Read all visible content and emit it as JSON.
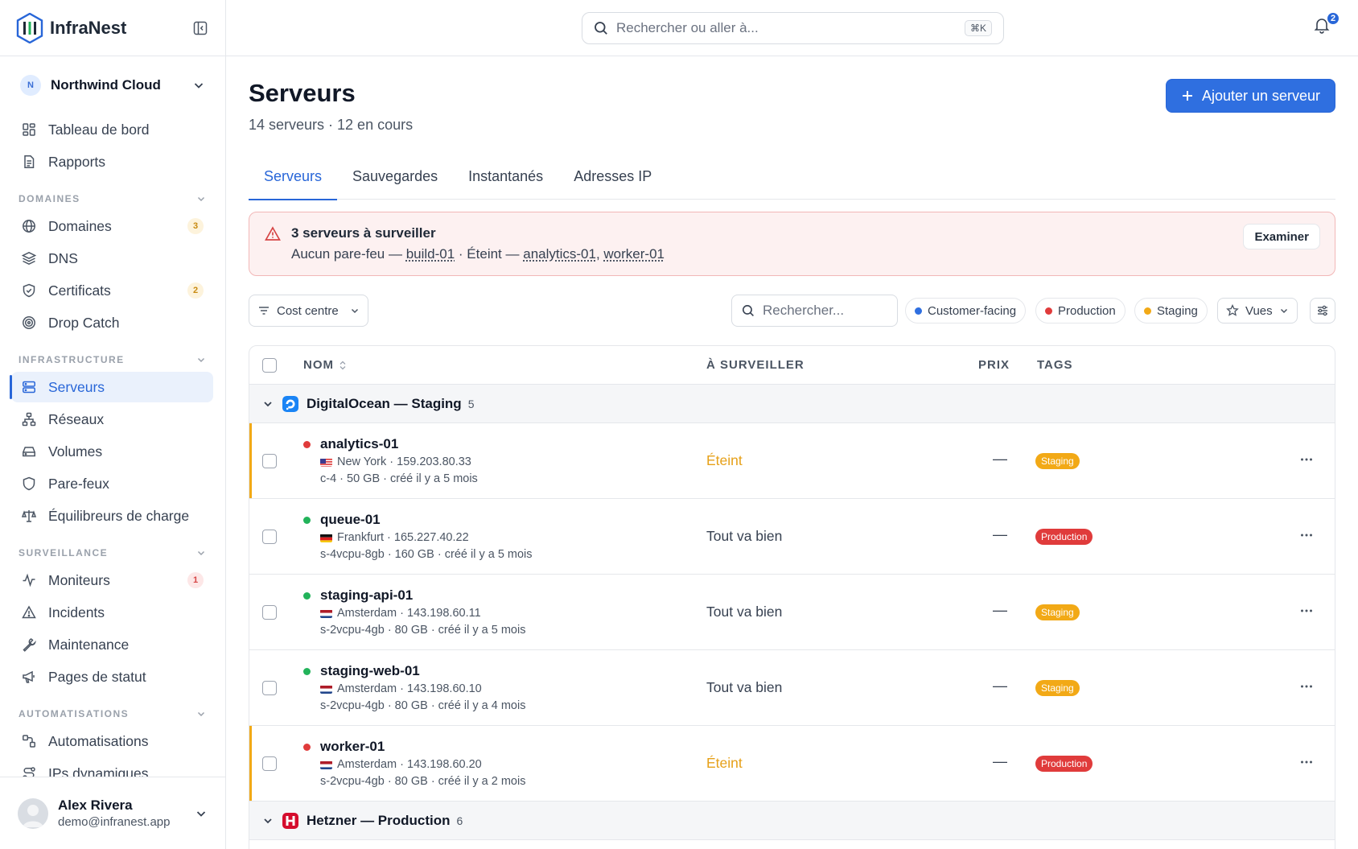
{
  "brand": {
    "name": "InfraNest"
  },
  "org": {
    "initial": "N",
    "name": "Northwind Cloud"
  },
  "nav_top": [
    {
      "label": "Tableau de bord",
      "icon": "dashboard-icon"
    },
    {
      "label": "Rapports",
      "icon": "report-icon"
    }
  ],
  "sections": {
    "domaines": "DOMAINES",
    "infrastructure": "INFRASTRUCTURE",
    "surveillance": "SURVEILLANCE",
    "automatisations": "AUTOMATISATIONS"
  },
  "nav_domaines": [
    {
      "label": "Domaines",
      "badge": "3"
    },
    {
      "label": "DNS"
    },
    {
      "label": "Certificats",
      "badge": "2"
    },
    {
      "label": "Drop Catch"
    }
  ],
  "nav_infra": [
    {
      "label": "Serveurs"
    },
    {
      "label": "Réseaux"
    },
    {
      "label": "Volumes"
    },
    {
      "label": "Pare-feux"
    },
    {
      "label": "Équilibreurs de charge"
    }
  ],
  "nav_surv": [
    {
      "label": "Moniteurs",
      "badge": "1"
    },
    {
      "label": "Incidents"
    },
    {
      "label": "Maintenance"
    },
    {
      "label": "Pages de statut"
    }
  ],
  "nav_auto": [
    {
      "label": "Automatisations"
    },
    {
      "label": "IPs dynamiques"
    }
  ],
  "user": {
    "name": "Alex Rivera",
    "email": "demo@infranest.app"
  },
  "topbar": {
    "search_placeholder": "Rechercher ou aller à...",
    "shortcut": "⌘K",
    "notif_count": "2"
  },
  "page": {
    "title": "Serveurs",
    "subtitle": "14 serveurs · 12 en cours",
    "add_button": "Ajouter un serveur"
  },
  "tabs": [
    "Serveurs",
    "Sauvegardes",
    "Instantanés",
    "Adresses IP"
  ],
  "alert": {
    "title": "3 serveurs à surveiller",
    "prefix1": "Aucun pare-feu — ",
    "link1": "build-01",
    "mid": " · Éteint — ",
    "link2": "analytics-01",
    "sep": ", ",
    "link3": "worker-01",
    "button": "Examiner"
  },
  "filters": {
    "cost_centre": "Cost centre",
    "search_placeholder": "Rechercher...",
    "chips": [
      "Customer-facing",
      "Production",
      "Staging"
    ],
    "views": "Vues"
  },
  "table": {
    "headers": {
      "name": "NOM",
      "watch": "À SURVEILLER",
      "price": "PRIX",
      "tags": "TAGS"
    },
    "groups": [
      {
        "name": "DigitalOcean — Staging",
        "count": "5"
      },
      {
        "name": "Hetzner — Production",
        "count": "6"
      }
    ],
    "rows": [
      {
        "name": "analytics-01",
        "location": "New York · 159.203.80.33",
        "spec": "c-4 · 50 GB · créé il y a 5 mois",
        "watch": "Éteint",
        "price": "—",
        "tag": "Staging"
      },
      {
        "name": "queue-01",
        "location": "Frankfurt · 165.227.40.22",
        "spec": "s-4vcpu-8gb · 160 GB · créé il y a 5 mois",
        "watch": "Tout va bien",
        "price": "—",
        "tag": "Production"
      },
      {
        "name": "staging-api-01",
        "location": "Amsterdam · 143.198.60.11",
        "spec": "s-2vcpu-4gb · 80 GB · créé il y a 5 mois",
        "watch": "Tout va bien",
        "price": "—",
        "tag": "Staging"
      },
      {
        "name": "staging-web-01",
        "location": "Amsterdam · 143.198.60.10",
        "spec": "s-2vcpu-4gb · 80 GB · créé il y a 4 mois",
        "watch": "Tout va bien",
        "price": "—",
        "tag": "Staging"
      },
      {
        "name": "worker-01",
        "location": "Amsterdam · 143.198.60.20",
        "spec": "s-2vcpu-4gb · 80 GB · créé il y a 2 mois",
        "watch": "Éteint",
        "price": "—",
        "tag": "Production"
      }
    ]
  },
  "colors": {
    "accent": "#2866d8",
    "staging": "#f2a916",
    "production": "#e03b3b",
    "running": "#22b35a",
    "off": "#e03b3b"
  }
}
